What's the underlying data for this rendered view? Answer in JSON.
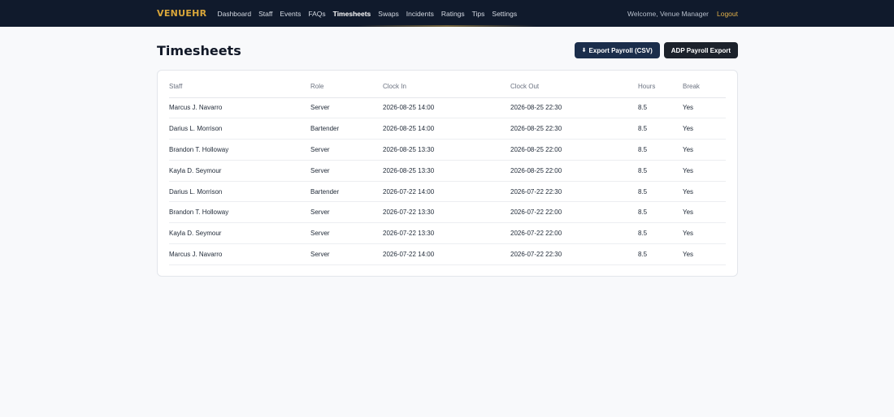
{
  "nav": {
    "brand": "VENUEHR",
    "links": [
      "Dashboard",
      "Staff",
      "Events",
      "FAQs",
      "Timesheets",
      "Swaps",
      "Incidents",
      "Ratings",
      "Tips",
      "Settings"
    ],
    "active": "Timesheets",
    "welcome": "Welcome, Venue Manager",
    "logout": "Logout"
  },
  "page": {
    "title": "Timesheets",
    "export_csv_label": "Export Payroll (CSV)",
    "export_csv_icon": "download-icon",
    "adp_label": "ADP Payroll Export"
  },
  "table": {
    "headers": [
      "Staff",
      "Role",
      "Clock In",
      "Clock Out",
      "Hours",
      "Break"
    ],
    "rows": [
      [
        "Marcus J. Navarro",
        "Server",
        "2026-08-25 14:00",
        "2026-08-25 22:30",
        "8.5",
        "Yes"
      ],
      [
        "Darius L. Morrison",
        "Bartender",
        "2026-08-25 14:00",
        "2026-08-25 22:30",
        "8.5",
        "Yes"
      ],
      [
        "Brandon T. Holloway",
        "Server",
        "2026-08-25 13:30",
        "2026-08-25 22:00",
        "8.5",
        "Yes"
      ],
      [
        "Kayla D. Seymour",
        "Server",
        "2026-08-25 13:30",
        "2026-08-25 22:00",
        "8.5",
        "Yes"
      ],
      [
        "Darius L. Morrison",
        "Bartender",
        "2026-07-22 14:00",
        "2026-07-22 22:30",
        "8.5",
        "Yes"
      ],
      [
        "Brandon T. Holloway",
        "Server",
        "2026-07-22 13:30",
        "2026-07-22 22:00",
        "8.5",
        "Yes"
      ],
      [
        "Kayla D. Seymour",
        "Server",
        "2026-07-22 13:30",
        "2026-07-22 22:00",
        "8.5",
        "Yes"
      ],
      [
        "Marcus J. Navarro",
        "Server",
        "2026-07-22 14:00",
        "2026-07-22 22:30",
        "8.5",
        "Yes"
      ]
    ]
  },
  "colors": {
    "navbar_bg": "#101a2c",
    "brand": "#d9a63a",
    "logout": "#e0b04a",
    "primary_button": "#1b2e4b",
    "dark_button": "#1c222b"
  }
}
